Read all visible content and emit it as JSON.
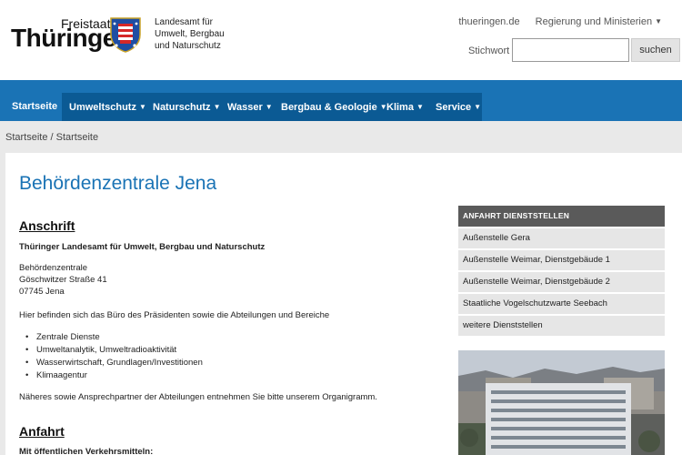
{
  "header": {
    "logo_small": "Freistaat",
    "logo_large": "Thüringen",
    "agency_lines": [
      "Landesamt für",
      "Umwelt, Bergbau",
      "und Naturschutz"
    ],
    "top_links": [
      {
        "label": "thueringen.de"
      },
      {
        "label": "Regierung und Ministerien"
      }
    ],
    "search_label": "Stichwort",
    "search_value": "",
    "search_button": "suchen"
  },
  "nav": {
    "items": [
      {
        "label": "Startseite",
        "active": true
      },
      {
        "label": "Umweltschutz"
      },
      {
        "label": "Naturschutz"
      },
      {
        "label": "Wasser"
      },
      {
        "label": "Bergbau & Geologie"
      },
      {
        "label": "Klima"
      },
      {
        "label": "Service"
      }
    ]
  },
  "breadcrumb": "Startseite / Startseite",
  "main": {
    "title": "Behördenzentrale Jena",
    "anschrift_heading": "Anschrift",
    "org_name": "Thüringer Landesamt für Umwelt, Bergbau und Naturschutz",
    "address": [
      "Behördenzentrale",
      "Göschwitzer Straße 41",
      "07745 Jena"
    ],
    "intro": "Hier befinden sich das Büro des Präsidenten sowie die Abteilungen und Bereiche",
    "departments": [
      "Zentrale Dienste",
      "Umweltanalytik, Umweltradioaktivität",
      "Wasserwirtschaft, Grundlagen/Investitionen",
      "Klimaagentur"
    ],
    "note": "Näheres sowie Ansprechpartner der Abteilungen entnehmen Sie bitte unserem Organigramm.",
    "anfahrt_heading": "Anfahrt",
    "transit_heading": "Mit öffentlichen Verkehrsmitteln:"
  },
  "sidebar": {
    "header": "ANFAHRT DIENSTSTELLEN",
    "items": [
      "Außenstelle Gera",
      "Außenstelle Weimar, Dienstgebäude 1",
      "Außenstelle Weimar, Dienstgebäude 2",
      "Staatliche Vogelschutzwarte Seebach",
      "weitere Dienststellen"
    ]
  },
  "colors": {
    "accent": "#1a73b5",
    "nav_dark": "#0b5a94",
    "sidebar_header": "#5a5a5a"
  }
}
